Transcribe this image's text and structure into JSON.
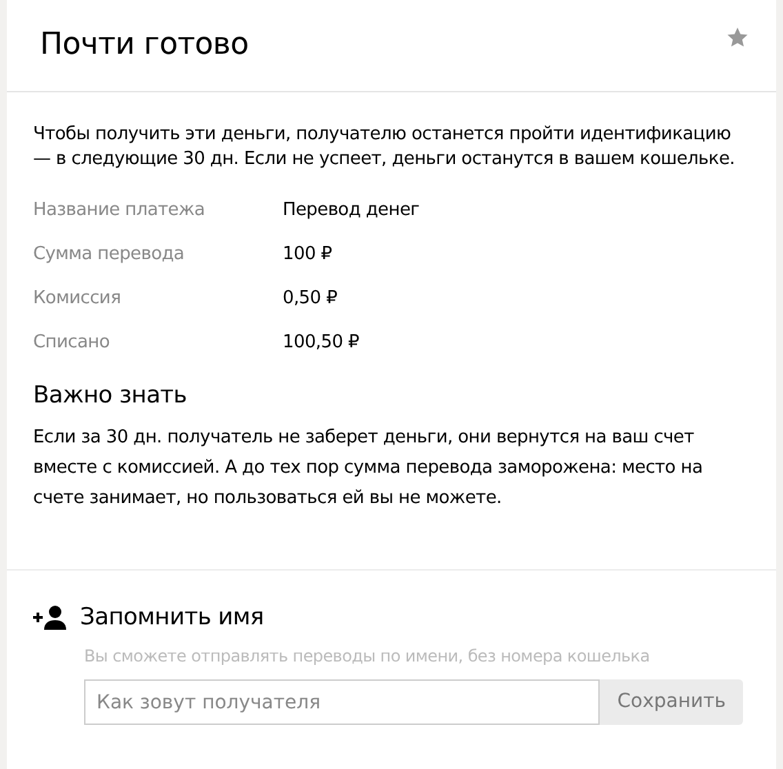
{
  "header": {
    "title": "Почти готово"
  },
  "notice": "Чтобы получить эти деньги, получателю останется пройти идентификацию — в следующие 30 дн. Если не успеет, деньги останутся в вашем кошельке.",
  "details": [
    {
      "label": "Название платежа",
      "value": "Перевод денег"
    },
    {
      "label": "Сумма перевода",
      "value": "100 ₽"
    },
    {
      "label": "Комиссия",
      "value": "0,50 ₽"
    },
    {
      "label": "Списано",
      "value": "100,50 ₽"
    }
  ],
  "important": {
    "heading": "Важно знать",
    "text": "Если за 30 дн. получатель не заберет деньги, они вернутся на ваш счет вместе с комиссией. А до тех пор сумма перевода заморожена: место на счете занимает, но пользоваться ей вы не можете."
  },
  "remember": {
    "heading": "Запомнить имя",
    "hint": "Вы сможете отправлять переводы по имени, без номера кошелька",
    "placeholder": "Как зовут получателя",
    "button": "Сохранить"
  }
}
